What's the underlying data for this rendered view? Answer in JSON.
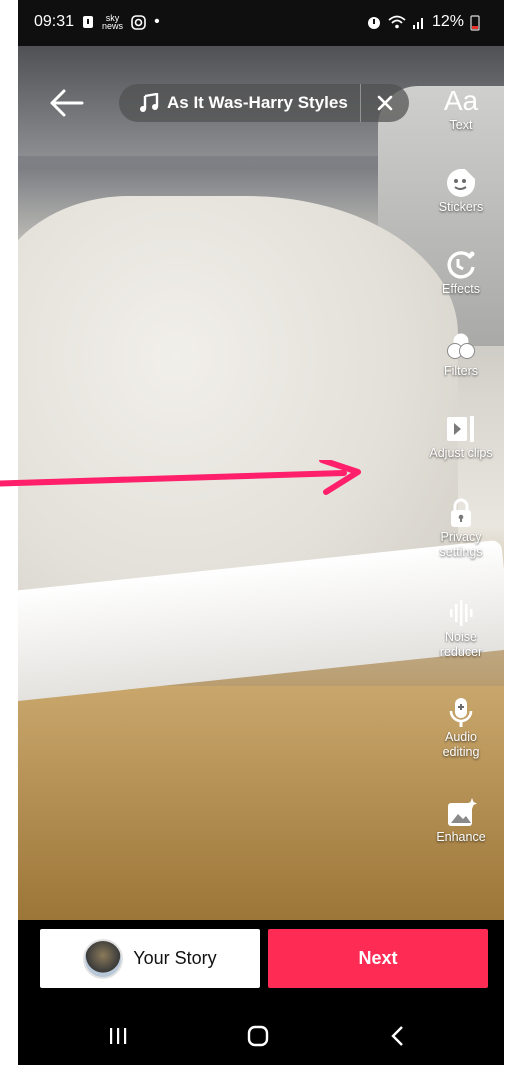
{
  "status_bar": {
    "time": "09:31",
    "news_badge_line1": "sky",
    "news_badge_line2": "news",
    "dot": "•",
    "battery": "12%"
  },
  "editor": {
    "music": {
      "title": "As It Was-Harry Styles"
    },
    "tools": [
      {
        "id": "text",
        "label": "Text",
        "icon": "text-icon",
        "glyph": "Aa"
      },
      {
        "id": "stickers",
        "label": "Stickers",
        "icon": "sticker-icon"
      },
      {
        "id": "effects",
        "label": "Effects",
        "icon": "effects-icon"
      },
      {
        "id": "filters",
        "label": "Filters",
        "icon": "filters-icon"
      },
      {
        "id": "adjust-clips",
        "label": "Adjust clips",
        "icon": "adjust-clips-icon"
      },
      {
        "id": "privacy",
        "label_line1": "Privacy",
        "label_line2": "settings",
        "icon": "lock-icon"
      },
      {
        "id": "noise",
        "label_line1": "Noise",
        "label_line2": "reducer",
        "icon": "noise-reducer-icon"
      },
      {
        "id": "audio",
        "label_line1": "Audio",
        "label_line2": "editing",
        "icon": "microphone-icon"
      },
      {
        "id": "enhance",
        "label": "Enhance",
        "icon": "enhance-icon"
      }
    ]
  },
  "bottom": {
    "your_story": "Your Story",
    "next": "Next"
  },
  "colors": {
    "next_button": "#fe2c55",
    "annotation_arrow": "#ff1f6b"
  }
}
